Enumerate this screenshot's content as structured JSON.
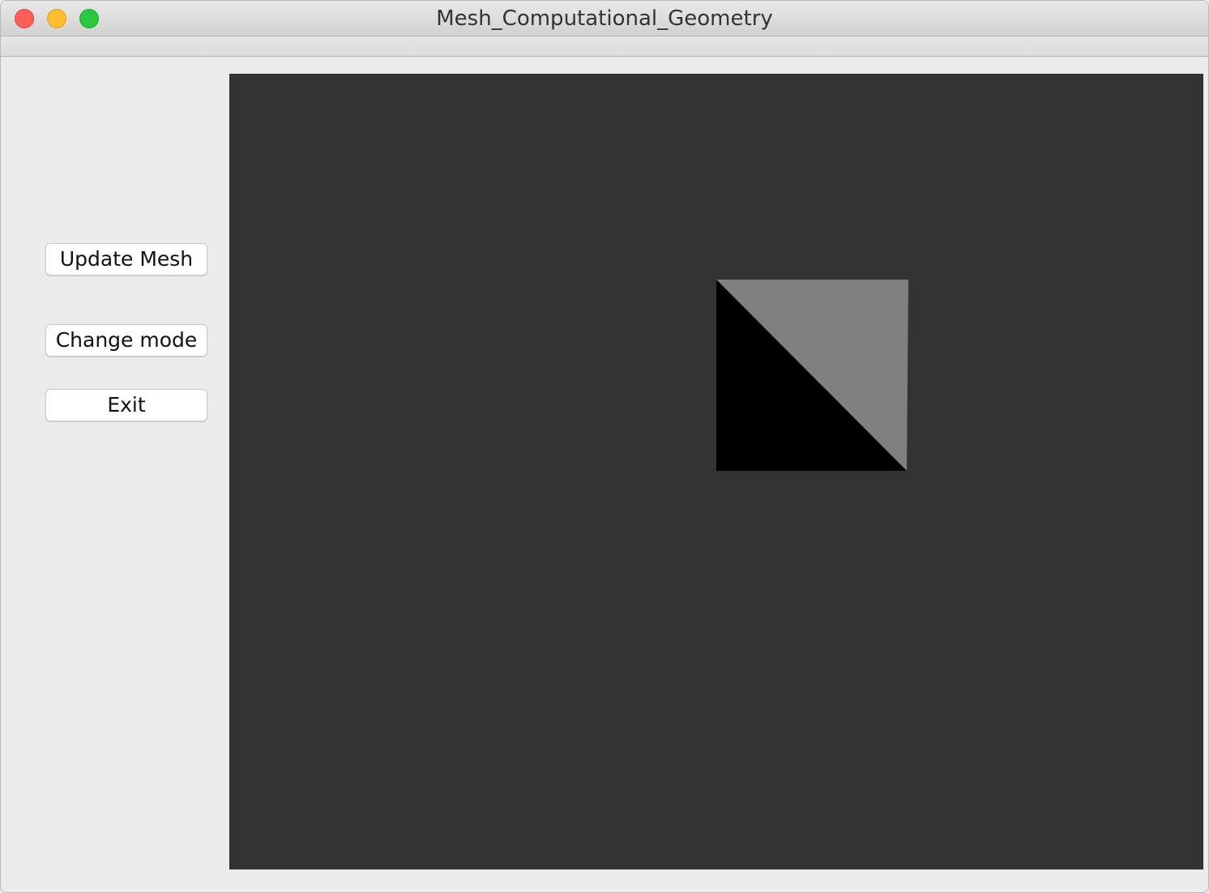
{
  "window": {
    "title": "Mesh_Computational_Geometry",
    "controls": [
      "close",
      "minimize",
      "zoom"
    ]
  },
  "sidebar": {
    "buttons": [
      {
        "label": "Update Mesh"
      },
      {
        "label": "Change mode"
      },
      {
        "label": "Exit"
      }
    ]
  },
  "viewport": {
    "background": "#333333",
    "mesh": {
      "triangles": [
        {
          "name": "upper-right-triangle",
          "color": "#808080"
        },
        {
          "name": "lower-left-triangle",
          "color": "#000000"
        }
      ]
    }
  }
}
